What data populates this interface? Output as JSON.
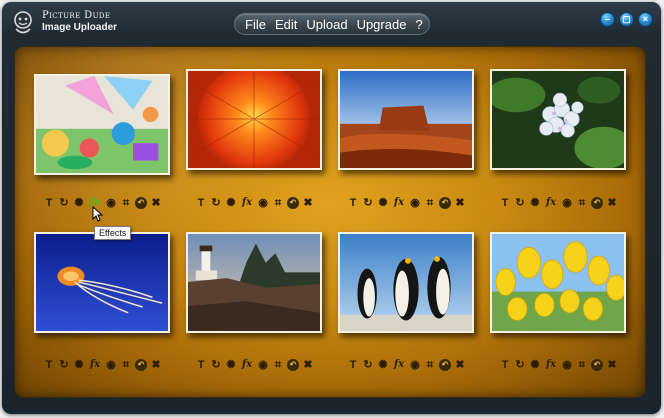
{
  "app": {
    "brand_line1": "Picture Dude",
    "brand_line2": "Image Uploader"
  },
  "menu": [
    "File",
    "Edit",
    "Upload",
    "Upgrade",
    "?"
  ],
  "window_controls": {
    "minimize_icon": "minimize-icon",
    "restore_icon": "restore-icon",
    "close_icon": "close-icon",
    "minimize_glyph": "–",
    "restore_glyph": "▢",
    "close_glyph": "×"
  },
  "tool_glyphs": {
    "text": "T",
    "rotate": "↻",
    "brightness": "✺",
    "effects": "fx",
    "preview": "◉",
    "crop": "⌗",
    "undo": "↶",
    "delete": "✖"
  },
  "tooltip": {
    "text": "Effects"
  },
  "photos": [
    {
      "id": "colorful-art",
      "name": "colorful-art-photo"
    },
    {
      "id": "red-chrysanthemum",
      "name": "red-chrysanthemum-photo"
    },
    {
      "id": "desert-mesa",
      "name": "desert-mesa-photo"
    },
    {
      "id": "hydrangea",
      "name": "hydrangea-photo"
    },
    {
      "id": "jellyfish",
      "name": "jellyfish-photo"
    },
    {
      "id": "lighthouse",
      "name": "lighthouse-photo"
    },
    {
      "id": "penguins",
      "name": "penguins-photo"
    },
    {
      "id": "tulips",
      "name": "tulips-photo"
    }
  ],
  "colors": {
    "accent_gold": "#d19519",
    "frame_dark": "#1a242c",
    "active_tool": "#3fbf1f"
  }
}
